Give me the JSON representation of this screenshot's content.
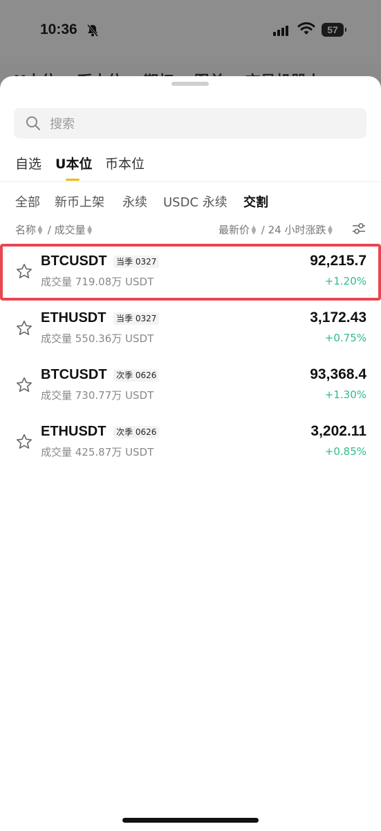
{
  "status_bar": {
    "time": "10:36",
    "battery": "57"
  },
  "background_tabs": [
    "U本位",
    "币本位",
    "期权",
    "跟单",
    "交易机器人"
  ],
  "search": {
    "placeholder": "搜索"
  },
  "top_tabs": [
    {
      "label": "自选",
      "active": false
    },
    {
      "label": "U本位",
      "active": true
    },
    {
      "label": "币本位",
      "active": false
    }
  ],
  "filters": [
    {
      "label": "全部",
      "active": false
    },
    {
      "label": "新币上架",
      "active": false
    },
    {
      "label": "永续",
      "active": false
    },
    {
      "label": "USDC 永续",
      "active": false
    },
    {
      "label": "交割",
      "active": true
    }
  ],
  "columns": {
    "name": "名称",
    "separator": "/",
    "volume": "成交量",
    "last_price": "最新价",
    "change_24h": "24 小时涨跌"
  },
  "rows": [
    {
      "symbol": "BTCUSDT",
      "badge": "当季 0327",
      "volume": "成交量 719.08万 USDT",
      "price": "92,215.7",
      "change": "+1.20%",
      "selected": true
    },
    {
      "symbol": "ETHUSDT",
      "badge": "当季 0327",
      "volume": "成交量 550.36万 USDT",
      "price": "3,172.43",
      "change": "+0.75%",
      "selected": false
    },
    {
      "symbol": "BTCUSDT",
      "badge": "次季 0626",
      "volume": "成交量 730.77万 USDT",
      "price": "93,368.4",
      "change": "+1.30%",
      "selected": false
    },
    {
      "symbol": "ETHUSDT",
      "badge": "次季 0626",
      "volume": "成交量 425.87万 USDT",
      "price": "3,202.11",
      "change": "+0.85%",
      "selected": false
    }
  ],
  "colors": {
    "accent": "#f0b90b",
    "positive": "#2ebd85",
    "highlight": "#e8474f"
  }
}
